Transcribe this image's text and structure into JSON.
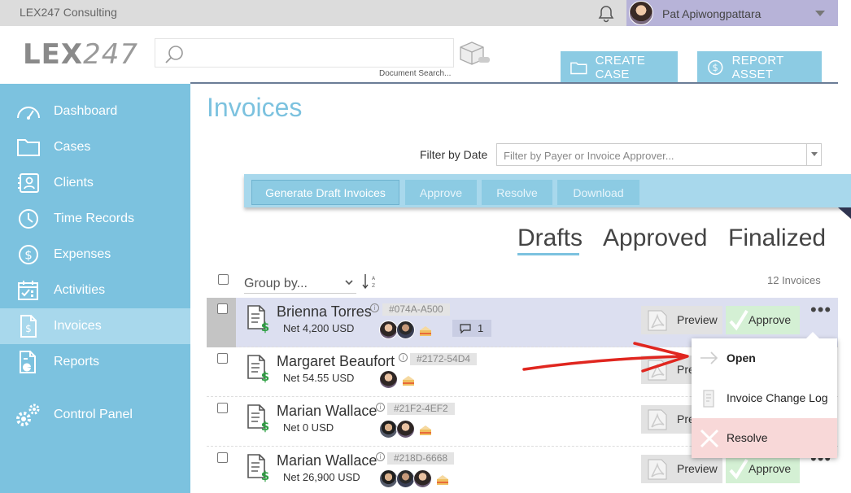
{
  "topbar": {
    "firm": "LEX247 Consulting",
    "user_name": "Pat Apiwongpattara"
  },
  "header": {
    "logo_bold": "LEX",
    "logo_light": "247",
    "search_placeholder": "",
    "search_caption": "Document Search...",
    "create_case": "CREATE CASE",
    "report_asset": "REPORT ASSET"
  },
  "sidebar": {
    "items": [
      {
        "label": "Dashboard",
        "icon": "gauge-icon"
      },
      {
        "label": "Cases",
        "icon": "folder-icon"
      },
      {
        "label": "Clients",
        "icon": "contacts-icon"
      },
      {
        "label": "Time Records",
        "icon": "clock-icon"
      },
      {
        "label": "Expenses",
        "icon": "dollar-circle-icon"
      },
      {
        "label": "Activities",
        "icon": "calendar-icon"
      },
      {
        "label": "Invoices",
        "icon": "invoice-icon",
        "active": true
      },
      {
        "label": "Reports",
        "icon": "report-icon"
      },
      {
        "label": "Control Panel",
        "icon": "gears-icon"
      }
    ]
  },
  "main": {
    "title": "Invoices",
    "filter_label": "Filter by Date",
    "filter_placeholder": "Filter by Payer or Invoice Approver...",
    "actions": {
      "generate": "Generate Draft Invoices",
      "approve": "Approve",
      "resolve": "Resolve",
      "download": "Download"
    },
    "tabs": [
      {
        "label": "Drafts",
        "active": true
      },
      {
        "label": "Approved"
      },
      {
        "label": "Finalized"
      }
    ],
    "group_by": "Group by...",
    "count": "12 Invoices"
  },
  "rows": [
    {
      "name": "Brienna Torres",
      "code": "#074A-A500",
      "net": "Net 4,200 USD",
      "comments": "1",
      "preview": "Preview",
      "approve": "Approve",
      "selected": true
    },
    {
      "name": "Margaret Beaufort",
      "code": "#2172-54D4",
      "net": "Net 54.55 USD",
      "preview": "Preview"
    },
    {
      "name": "Marian Wallace",
      "code": "#21F2-4EF2",
      "net": "Net 0 USD",
      "preview": "Preview"
    },
    {
      "name": "Marian Wallace",
      "code": "#218D-6668",
      "net": "Net 26,900 USD",
      "preview": "Preview",
      "approve": "Approve"
    }
  ],
  "menu": {
    "open": "Open",
    "log": "Invoice Change Log",
    "resolve": "Resolve"
  },
  "colors": {
    "sidebar": "#7cc2df",
    "accent": "#8ccbe3",
    "approve_bg": "#d4f0d4",
    "resolve_bg": "#f8d8d8",
    "arrow": "#e0261f"
  }
}
